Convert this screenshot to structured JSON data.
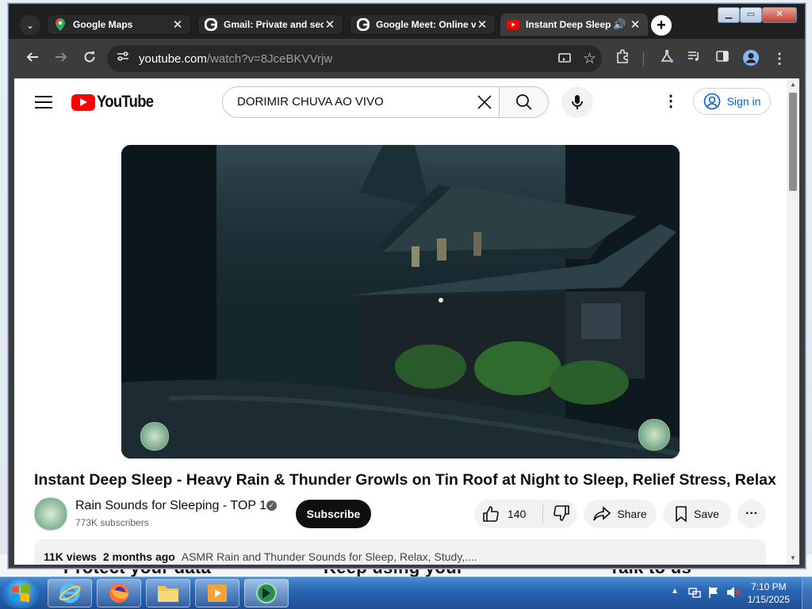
{
  "behind_page": {
    "text_1": "Protect your data",
    "text_2": "Keep using your",
    "text_3": "Talk to us"
  },
  "browser": {
    "tabs": [
      {
        "title": "Google Maps",
        "icon": "maps-icon"
      },
      {
        "title": "Gmail: Private and secure",
        "icon": "google-icon"
      },
      {
        "title": "Google Meet: Online video",
        "icon": "google-icon"
      },
      {
        "title": "Instant Deep Sleep - Heavy Rain",
        "icon": "youtube-icon",
        "active": true,
        "audio": true
      }
    ],
    "url_host": "youtube.com",
    "url_path": "/watch?v=8JceBKVVrjw"
  },
  "youtube": {
    "logo_text": "YouTube",
    "search_value": "DORIMIR CHUVA AO VIVO",
    "sign_in_label": "Sign in",
    "video_title": "Instant Deep Sleep - Heavy Rain & Thunder Growls on Tin Roof at Night to Sleep, Relief Stress, Relax",
    "channel_name": "Rain Sounds for Sleeping - TOP 1",
    "subscribers": "773K subscribers",
    "subscribe_label": "Subscribe",
    "likes": "140",
    "share_label": "Share",
    "save_label": "Save",
    "views": "11K views",
    "age": "2 months ago",
    "description_snippet": "ASMR Rain and Thunder Sounds for Sleep, Relax, Study,...."
  },
  "taskbar": {
    "time": "7:10 PM",
    "date": "1/15/2025"
  },
  "colors": {
    "youtube_red": "#ff0000",
    "link_blue": "#065fd4",
    "chrome_dark": "#3c3c3c"
  }
}
